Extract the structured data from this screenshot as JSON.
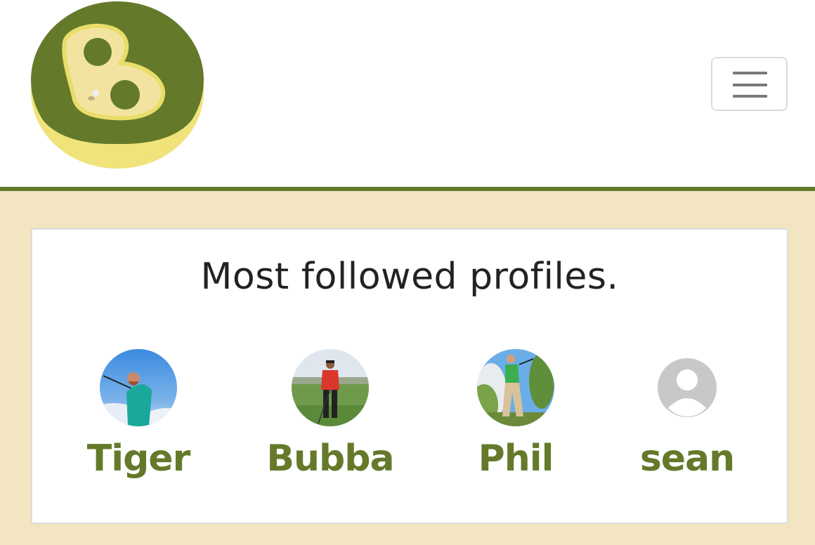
{
  "brand": {
    "logo_name": "brand-logo",
    "colors": {
      "primary": "#647a2a",
      "light": "#f0e37a",
      "background": "#f3e5c1"
    }
  },
  "navbar": {
    "toggler_icon": "hamburger-menu-icon"
  },
  "card": {
    "title": "Most followed profiles."
  },
  "profiles": [
    {
      "name": "Tiger",
      "avatar": "golfer-photo"
    },
    {
      "name": "Bubba",
      "avatar": "golfer-photo"
    },
    {
      "name": "Phil",
      "avatar": "golfer-photo"
    },
    {
      "name": "sean",
      "avatar": "default-user-icon"
    }
  ]
}
